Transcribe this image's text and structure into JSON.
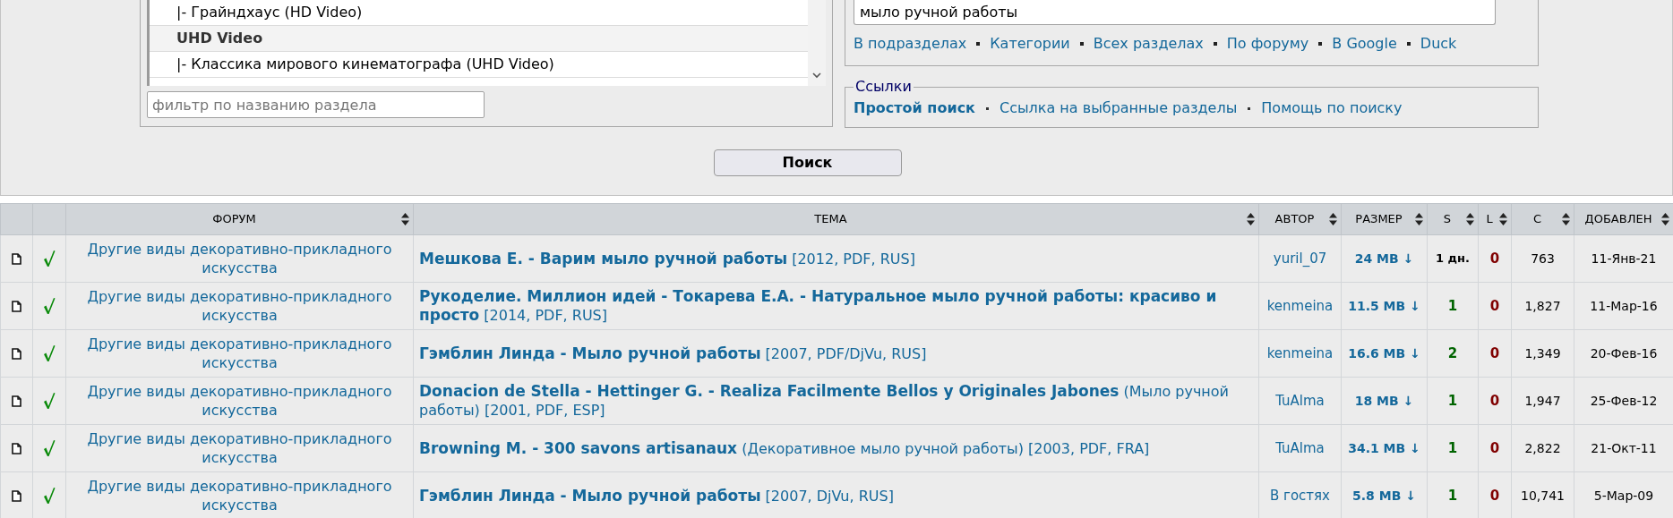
{
  "section_list": {
    "items": [
      {
        "kind": "item",
        "label": "|- Грайндхаус (HD Video)"
      },
      {
        "kind": "group",
        "label": "UHD Video"
      },
      {
        "kind": "item",
        "label": "|- Классика мирового кинематографа (UHD Video)"
      }
    ],
    "filter": {
      "placeholder": "фильтр по названию раздела"
    }
  },
  "search": {
    "value": "мыло ручной работы",
    "scopes": [
      "В подразделах",
      "Категории",
      "Всех разделах",
      "По форуму",
      "В Google",
      "Duck"
    ]
  },
  "links": {
    "legend": "Ссылки",
    "items": [
      {
        "label": "Простой поиск",
        "current": true
      },
      {
        "label": "Ссылка на выбранные разделы",
        "current": false
      },
      {
        "label": "Помощь по поиску",
        "current": false
      }
    ]
  },
  "search_button": "Поиск",
  "table": {
    "columns": [
      "ФОРУМ",
      "ТЕМА",
      "АВТОР",
      "РАЗМЕР",
      "S",
      "L",
      "C",
      "ДОБАВЛЕН"
    ],
    "rows": [
      {
        "verified": true,
        "forum": "Другие виды декоративно-прикладного искусства",
        "topic": "**Мешкова Е. - Варим мыло ручной работы** [2012, PDF, RUS]",
        "author": "yuril_07",
        "size": "24 MB ↓",
        "seeds": {
          "kind": "age",
          "text": "1 дн."
        },
        "leechers": "0",
        "completed": "763",
        "added": "11-Янв-21"
      },
      {
        "verified": true,
        "forum": "Другие виды декоративно-прикладного искусства",
        "topic": "**Рукоделие. Миллион идей - Токарева Е.А. - Натуральное мыло ручной работы: красиво и просто** [2014, PDF, RUS]",
        "author": "kenmeina",
        "size": "11.5 MB ↓",
        "seeds": {
          "kind": "count",
          "text": "1"
        },
        "leechers": "0",
        "completed": "1,827",
        "added": "11-Мар-16"
      },
      {
        "verified": true,
        "forum": "Другие виды декоративно-прикладного искусства",
        "topic": "**Гэмблин Линда - Мыло ручной работы** [2007, PDF/DjVu, RUS]",
        "author": "kenmeina",
        "size": "16.6 MB ↓",
        "seeds": {
          "kind": "count",
          "text": "2"
        },
        "leechers": "0",
        "completed": "1,349",
        "added": "20-Фев-16"
      },
      {
        "verified": true,
        "forum": "Другие виды декоративно-прикладного искусства",
        "topic": "**Donacion de Stella - Hettinger G. - Realiza Facilmente Bellos y Originales Jabones** (Мыло ручной работы) [2001, PDF, ESP]",
        "author": "TuAlma",
        "size": "18 MB ↓",
        "seeds": {
          "kind": "count",
          "text": "1"
        },
        "leechers": "0",
        "completed": "1,947",
        "added": "25-Фев-12"
      },
      {
        "verified": true,
        "forum": "Другие виды декоративно-прикладного искусства",
        "topic": "**Browning M. - 300 savons artisanaux** (Декоративное мыло ручной работы) [2003, PDF, FRA]",
        "author": "TuAlma",
        "size": "34.1 MB ↓",
        "seeds": {
          "kind": "count",
          "text": "1"
        },
        "leechers": "0",
        "completed": "2,822",
        "added": "21-Окт-11"
      },
      {
        "verified": true,
        "forum": "Другие виды декоративно-прикладного искусства",
        "topic": "**Гэмблин Линда - Мыло ручной работы** [2007, DjVu, RUS]",
        "author": "В гостях",
        "size": "5.8 MB ↓",
        "seeds": {
          "kind": "count",
          "text": "1"
        },
        "leechers": "0",
        "completed": "10,741",
        "added": "5-Мар-09"
      }
    ]
  }
}
